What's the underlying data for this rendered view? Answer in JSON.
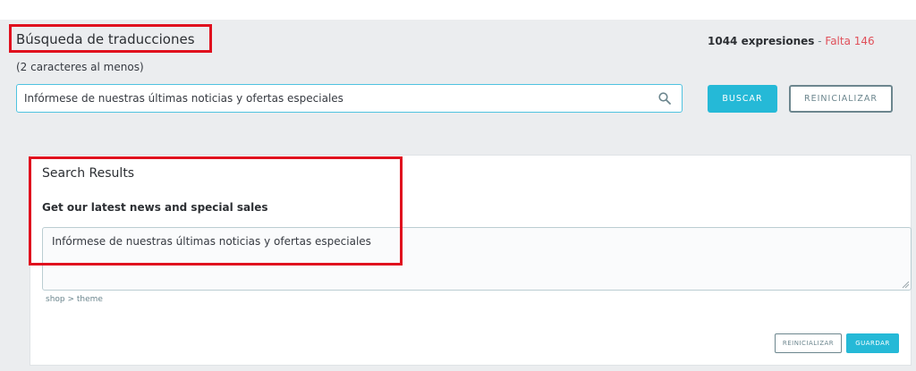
{
  "header": {
    "title": "Búsqueda de traducciones",
    "stats_count": "1044 expresiones",
    "stats_separator": " - ",
    "stats_missing": "Falta 146"
  },
  "search": {
    "hint": "(2 caracteres al menos)",
    "value": "Infórmese de nuestras últimas noticias y ofertas especiales",
    "search_button": "BUSCAR",
    "reset_button": "REINICIALIZAR"
  },
  "results": {
    "title": "Search Results",
    "source_label": "Get our latest news and special sales",
    "translation_value": "Infórmese de nuestras últimas noticias y ofertas especiales",
    "path": "shop > theme",
    "reset_button": "REINICIALIZAR",
    "save_button": "GUARDAR"
  },
  "colors": {
    "accent": "#25b9d7",
    "highlight": "#e0101e",
    "missing": "#e0505a"
  },
  "icons": {
    "search": "search-icon",
    "resize": "resize-grip-icon"
  }
}
